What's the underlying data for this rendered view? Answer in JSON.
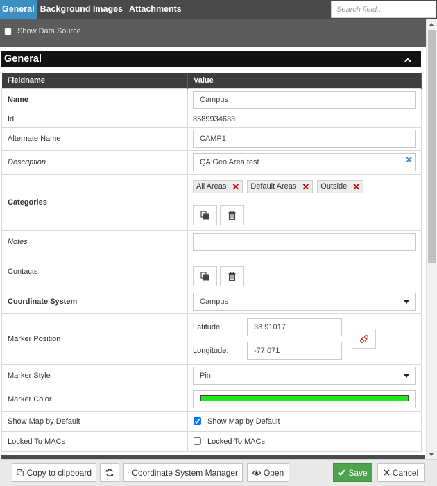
{
  "tabs": [
    "General",
    "Background Images",
    "Attachments"
  ],
  "search": {
    "placeholder": "Search field..."
  },
  "data_source": {
    "label": "Show Data Source",
    "checked": false
  },
  "section": {
    "title": "General"
  },
  "table": {
    "headers": {
      "fieldname": "Fieldname",
      "value": "Value"
    },
    "name": {
      "label": "Name",
      "value": "Campus"
    },
    "id": {
      "label": "Id",
      "value": "8589934633"
    },
    "alternate_name": {
      "label": "Alternate Name",
      "value": "CAMP1"
    },
    "description": {
      "label": "Description",
      "value": "QA Geo Area test"
    },
    "categories": {
      "label": "Categories",
      "items": [
        "All Areas",
        "Default Areas",
        "Outside"
      ]
    },
    "notes": {
      "label": "Notes",
      "value": ""
    },
    "contacts": {
      "label": "Contacts"
    },
    "coordinate_system": {
      "label": "Coordinate System",
      "value": "Campus"
    },
    "marker_position": {
      "label": "Marker Position",
      "latitude_label": "Latitude:",
      "latitude": "38.91017",
      "longitude_label": "Longitude:",
      "longitude": "-77.071"
    },
    "marker_style": {
      "label": "Marker Style",
      "value": "Pin"
    },
    "marker_color": {
      "label": "Marker Color",
      "color": "#1ee91e"
    },
    "show_map": {
      "label": "Show Map by Default",
      "checkbox_label": "Show Map by Default",
      "checked": true
    },
    "locked": {
      "label": "Locked To MACs",
      "checkbox_label": "Locked To MACs",
      "checked": false
    }
  },
  "footer": {
    "copy": "Copy to clipboard",
    "coord_manager": "Coordinate System Manager",
    "open": "Open",
    "save": "Save",
    "cancel": "Cancel"
  },
  "colors": {
    "tab_active": "#3b8fc2",
    "save": "#4ca54c",
    "remove": "#d40000"
  }
}
